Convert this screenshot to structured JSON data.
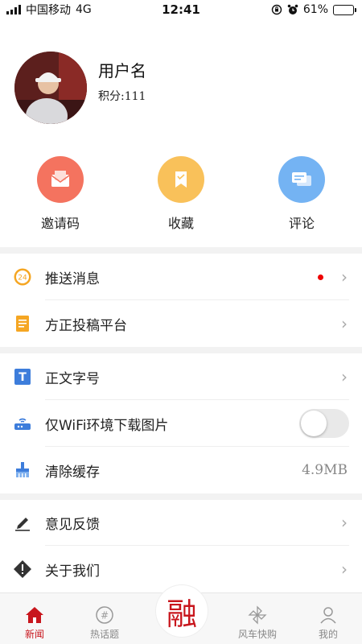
{
  "status_bar": {
    "carrier": "中国移动",
    "network": "4G",
    "time": "12:41",
    "battery": "61%",
    "battery_level": 0.61
  },
  "profile": {
    "username": "用户名",
    "points": "积分:111"
  },
  "quick_actions": [
    {
      "label": "邀请码",
      "icon": "envelope-icon",
      "color": "#f4735f"
    },
    {
      "label": "收藏",
      "icon": "bookmark-icon",
      "color": "#f9c15a"
    },
    {
      "label": "评论",
      "icon": "comment-icon",
      "color": "#74b3f3"
    }
  ],
  "menu": {
    "push_messages": {
      "label": "推送消息",
      "badge_icon_text": "24"
    },
    "submission_platform": {
      "label": "方正投稿平台"
    },
    "font_size": {
      "label": "正文字号",
      "icon_text": "T"
    },
    "wifi_download": {
      "label": "仅WiFi环境下载图片",
      "enabled": false
    },
    "clear_cache": {
      "label": "清除缓存",
      "value": "4.9MB"
    },
    "feedback": {
      "label": "意见反馈"
    },
    "about": {
      "label": "关于我们"
    }
  },
  "tabbar": {
    "news": "新闻",
    "hot_topics": "热话题",
    "center": "融",
    "windmill_shop": "风车快购",
    "mine": "我的"
  },
  "colors": {
    "accent": "#c8161d"
  }
}
